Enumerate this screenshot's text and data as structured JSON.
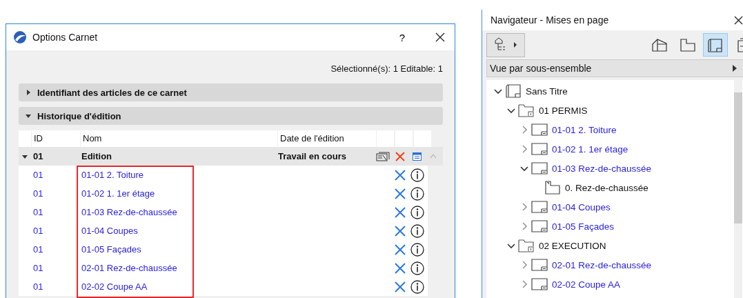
{
  "dialog": {
    "title": "Options Carnet",
    "help": "?",
    "status": "Sélectionné(s): 1 Editable: 1",
    "sections": [
      {
        "title": "Identifiant des articles de ce carnet",
        "expanded": false
      },
      {
        "title": "Historique d'édition",
        "expanded": true
      }
    ],
    "table": {
      "columns": [
        "ID",
        "Nom",
        "Date de l'édition"
      ],
      "group": {
        "id": "01",
        "name": "Edition",
        "date": "Travail en cours",
        "expanded": true
      },
      "rows": [
        {
          "id": "01",
          "name": "01-01 2. Toiture"
        },
        {
          "id": "01",
          "name": "01-02 1. 1er étage"
        },
        {
          "id": "01",
          "name": "01-03 Rez-de-chaussée"
        },
        {
          "id": "01",
          "name": "01-04 Coupes"
        },
        {
          "id": "01",
          "name": "01-05 Façades"
        },
        {
          "id": "01",
          "name": "02-01 Rez-de-chaussée"
        },
        {
          "id": "01",
          "name": "02-02 Coupe AA"
        }
      ]
    }
  },
  "navigator": {
    "title": "Navigateur - Mises en page",
    "view_modes": [
      {
        "kind": "model",
        "selected": false
      },
      {
        "kind": "plan",
        "selected": false
      },
      {
        "kind": "layout",
        "selected": true
      },
      {
        "kind": "publish",
        "selected": false
      }
    ],
    "dropdown": "Vue par sous-ensemble",
    "tree": [
      {
        "kind": "book",
        "label": "Sans Titre",
        "expanded": true,
        "children": [
          {
            "kind": "subset",
            "label": "01 PERMIS",
            "expanded": true,
            "children": [
              {
                "kind": "layout",
                "label": "01-01 2. Toiture",
                "expanded": false
              },
              {
                "kind": "layout",
                "label": "01-02 1. 1er étage",
                "expanded": false
              },
              {
                "kind": "layout",
                "label": "01-03 Rez-de-chaussée",
                "expanded": true,
                "children": [
                  {
                    "kind": "view",
                    "label": "0. Rez-de-chaussée"
                  }
                ]
              },
              {
                "kind": "layout",
                "label": "01-04 Coupes",
                "expanded": false
              },
              {
                "kind": "layout",
                "label": "01-05 Façades",
                "expanded": false
              }
            ]
          },
          {
            "kind": "subset",
            "label": "02 EXECUTION",
            "expanded": true,
            "children": [
              {
                "kind": "layout",
                "label": "02-01 Rez-de-chaussée",
                "expanded": false
              },
              {
                "kind": "layout",
                "label": "02-02 Coupe AA",
                "expanded": false
              }
            ]
          }
        ]
      }
    ]
  }
}
